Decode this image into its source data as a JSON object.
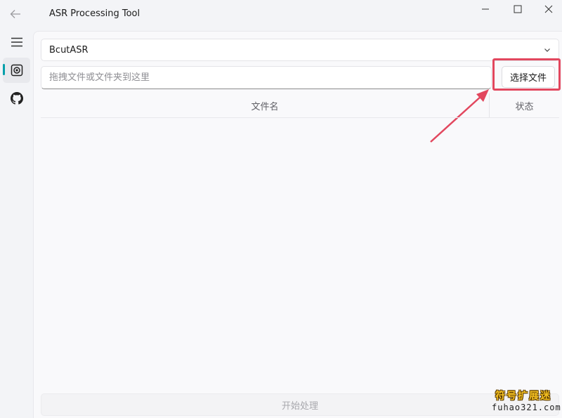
{
  "window": {
    "title": "ASR Processing Tool"
  },
  "sidebar": {
    "items": [
      {
        "icon": "menu-icon",
        "active": false
      },
      {
        "icon": "transcribe-icon",
        "active": true
      },
      {
        "icon": "github-icon",
        "active": false
      }
    ]
  },
  "main": {
    "engine_select": {
      "value": "BcutASR"
    },
    "file_input": {
      "placeholder": "拖拽文件或文件夹到这里",
      "value": ""
    },
    "select_file_label": "选择文件",
    "table": {
      "columns": [
        "文件名",
        "状态"
      ],
      "rows": []
    },
    "start_label": "开始处理"
  },
  "watermark": {
    "line1": "符号扩展迷",
    "line2": "fuhao321.com"
  },
  "colors": {
    "accent": "#009faa",
    "highlight": "#e2475e"
  }
}
